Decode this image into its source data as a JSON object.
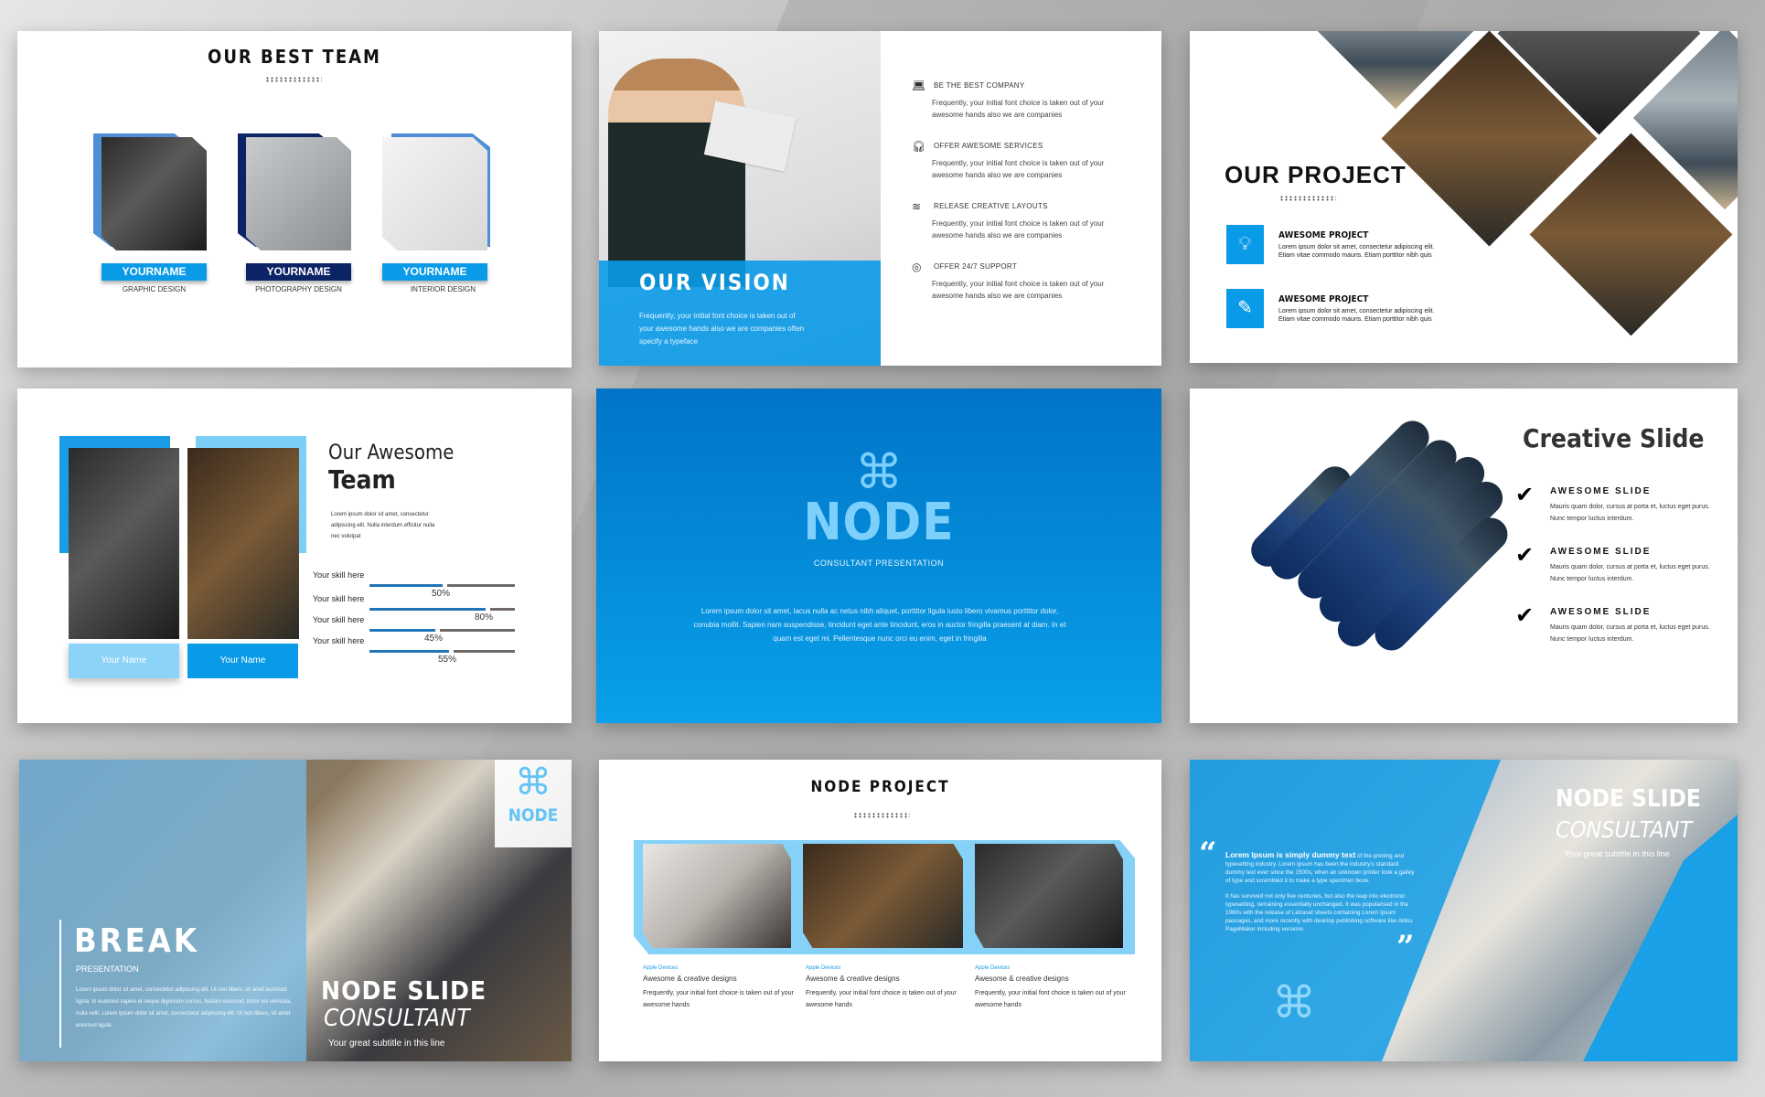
{
  "colors": {
    "accent": "#0a9be8",
    "navy": "#0c2466",
    "light_blue": "#7ccff7",
    "background": "#bdbdbd"
  },
  "slides": {
    "team": {
      "title": "OUR BEST TEAM",
      "members": [
        {
          "name": "YOURNAME",
          "role": "GRAPHIC DESIGN"
        },
        {
          "name": "YOURNAME",
          "role": "PHOTOGRAPHY DESIGN"
        },
        {
          "name": "YOURNAME",
          "role": "INTERIOR DESIGN"
        }
      ]
    },
    "vision": {
      "title": "OUR VISION",
      "body": "Frequently, your initial font choice is taken out of your awesome hands also we are companies often specify a typeface",
      "features": [
        {
          "icon": "laptop-icon",
          "title": "BE THE BEST COMPANY",
          "desc": "Frequently, your initial font choice is taken out of your awesome hands also we are companies"
        },
        {
          "icon": "headphones-icon",
          "title": "OFFER AWESOME SERVICES",
          "desc": "Frequently, your initial font choice is taken out of your awesome hands also we are companies"
        },
        {
          "icon": "layers-icon",
          "title": "RELEASE CREATIVE LAYOUTS",
          "desc": "Frequently, your initial font choice is taken out of your awesome hands also we are companies"
        },
        {
          "icon": "lifebuoy-icon",
          "title": "OFFER 24/7 SUPPORT",
          "desc": "Frequently, your initial font choice is taken out of your awesome hands also we are companies"
        }
      ]
    },
    "project": {
      "title": "OUR PROJECT",
      "items": [
        {
          "icon": "lightbulb-icon",
          "title": "AWESOME PROJECT",
          "desc": "Lorem ipsum dolor sit amet, consectetur adipiscing elit. Etiam vitae commodo mauris. Etiam porttitor nibh quis"
        },
        {
          "icon": "tools-icon",
          "title": "AWESOME PROJECT",
          "desc": "Lorem ipsum dolor sit amet, consectetur adipiscing elit. Etiam vitae commodo mauris. Etiam porttitor nibh quis"
        }
      ]
    },
    "awesome_team": {
      "title_line1": "Our Awesome",
      "title_line2": "Team",
      "body": "Lorem ipsum dolor sit amet, consectetur adipiscing elit. Nulla interdum efficitur nulla nec volutpat",
      "names": [
        "Your Name",
        "Your Name"
      ],
      "skills": [
        {
          "label": "Your skill here",
          "percent": 50,
          "percent_label": "50%"
        },
        {
          "label": "Your skill here",
          "percent": 80,
          "percent_label": "80%"
        },
        {
          "label": "Your skill here",
          "percent": 45,
          "percent_label": "45%"
        },
        {
          "label": "Your skill here",
          "percent": 55,
          "percent_label": "55%"
        }
      ]
    },
    "cover": {
      "logo_glyph": "⌘",
      "title": "NODE",
      "subtitle": "CONSULTANT PRESENTATION",
      "body": "Lorem ipsum dolor sit amet, lacus nulla ac netus nibh aliquet, porttitor ligula iusto libero vivamus porttitor dolor, conubia mollit. Sapien nam suspendisse, tincidunt eget ante tincidunt, eros in auctor fringilla praesent at diam. In et quam est eget mi. Pellentesque nunc orci eu enim, eget in fringilla"
    },
    "creative": {
      "title": "Creative Slide",
      "items": [
        {
          "title": "AWESOME SLIDE",
          "desc": "Mauris quam dolor, cursus at porta et, luctus eget purus. Nunc tempor luctus interdum."
        },
        {
          "title": "AWESOME SLIDE",
          "desc": "Mauris quam dolor, cursus at porta et, luctus eget purus. Nunc tempor luctus interdum."
        },
        {
          "title": "AWESOME SLIDE",
          "desc": "Mauris quam dolor, cursus at porta et, luctus eget purus. Nunc tempor luctus interdum."
        }
      ]
    },
    "break": {
      "title": "BREAK",
      "subtitle": "PRESENTATION",
      "body": "Lorem ipsum dolor sit amet, consectetur adipiscing elit. Ut non libero, sit amet euismod ligula. In euismod sapien et neque dignissim cursus. Nullam euismod, tortor vel vehicula, nulla velit. Lorem ipsum dolor sit amet, consectetur adipiscing elit. Ut non libero, sit amet euismod ligula.",
      "logo_glyph": "⌘",
      "logo_text": "NODE",
      "headline1": "NODE SLIDE",
      "headline2": "CONSULTANT",
      "tagline": "Your great subtitle in this line"
    },
    "node_project": {
      "title": "NODE PROJECT",
      "cards": [
        {
          "tag": "Apple Devices",
          "title": "Awesome & creative designs",
          "desc": "Frequently, your initial font choice is taken out of your awesome hands"
        },
        {
          "tag": "Apple Devices",
          "title": "Awesome & creative designs",
          "desc": "Frequently, your initial font choice is taken out of your awesome hands"
        },
        {
          "tag": "Apple Devices",
          "title": "Awesome & creative designs",
          "desc": "Frequently, your initial font choice is taken out of your awesome hands"
        }
      ]
    },
    "consultant": {
      "quote_open": "“",
      "quote_close": "”",
      "quote_lead": "Lorem Ipsum is simply dummy text",
      "quote_p1": " of the printing and typesetting industry. Lorem Ipsum has been the industry's standard dummy text ever since the 1500s, when an unknown printer took a galley of type and scrambled it to make a type specimen book.",
      "quote_p2": "It has survived not only five centuries, but also the leap into electronic typesetting, remaining essentially unchanged. It was popularised in the 1960s with the release of Letraset sheets containing Lorem Ipsum passages, and more recently with desktop publishing software like Aldus PageMaker including versions",
      "logo_glyph": "⌘",
      "headline1": "NODE SLIDE",
      "headline2": "CONSULTANT",
      "tagline": "Your great subtitle in this line"
    }
  }
}
